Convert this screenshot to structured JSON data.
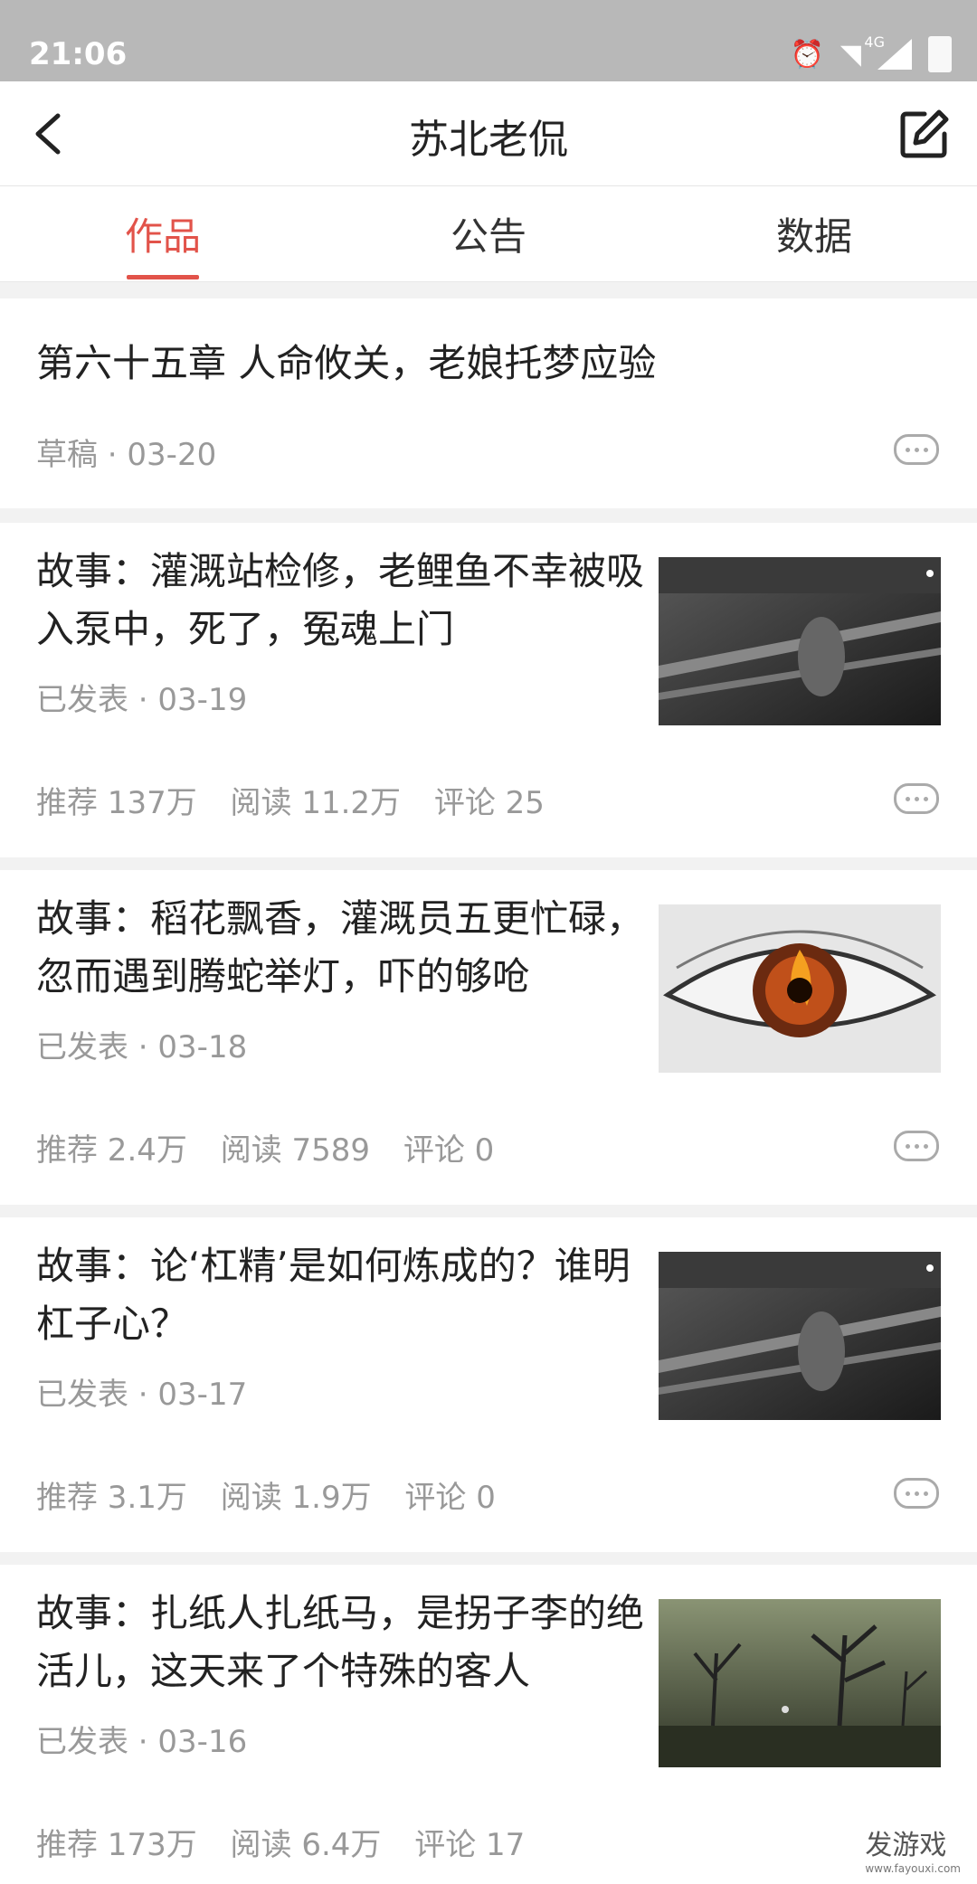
{
  "status_bar": {
    "time": "21:06",
    "network": "4G"
  },
  "nav": {
    "title": "苏北老侃"
  },
  "tabs": [
    {
      "label": "作品",
      "active": true
    },
    {
      "label": "公告",
      "active": false
    },
    {
      "label": "数据",
      "active": false
    }
  ],
  "items": [
    {
      "title": "第六十五章 人命攸关，老娘托梦应验",
      "meta": "草稿 · 03-20"
    },
    {
      "title": "故事：灌溉站检修，老鲤鱼不幸被吸入泵中，死了，冤魂上门",
      "meta": "已发表 · 03-19",
      "recommend": "推荐 137万",
      "read": "阅读 11.2万",
      "comment": "评论 25",
      "thumb_icon": "night-railing-photo"
    },
    {
      "title": "故事：稻花飘香，灌溉员五更忙碌，忽而遇到腾蛇举灯，吓的够呛",
      "meta": "已发表 · 03-18",
      "recommend": "推荐 2.4万",
      "read": "阅读 7589",
      "comment": "评论 0",
      "thumb_icon": "fire-eye-photo"
    },
    {
      "title": "故事：论‘杠精’是如何炼成的？谁明杠子心？",
      "meta": "已发表 · 03-17",
      "recommend": "推荐 3.1万",
      "read": "阅读 1.9万",
      "comment": "评论 0",
      "thumb_icon": "night-railing-photo"
    },
    {
      "title": "故事：扎纸人扎纸马，是拐子李的绝活儿，这天来了个特殊的客人",
      "meta": "已发表 · 03-16",
      "recommend": "推荐 173万",
      "read": "阅读 6.4万",
      "comment": "评论 17",
      "thumb_icon": "dead-trees-photo"
    }
  ],
  "watermark": {
    "name": "发游戏",
    "url": "www.fayouxi.com"
  },
  "colors": {
    "accent": "#e2534a",
    "status_bar": "#b8b8b8"
  }
}
